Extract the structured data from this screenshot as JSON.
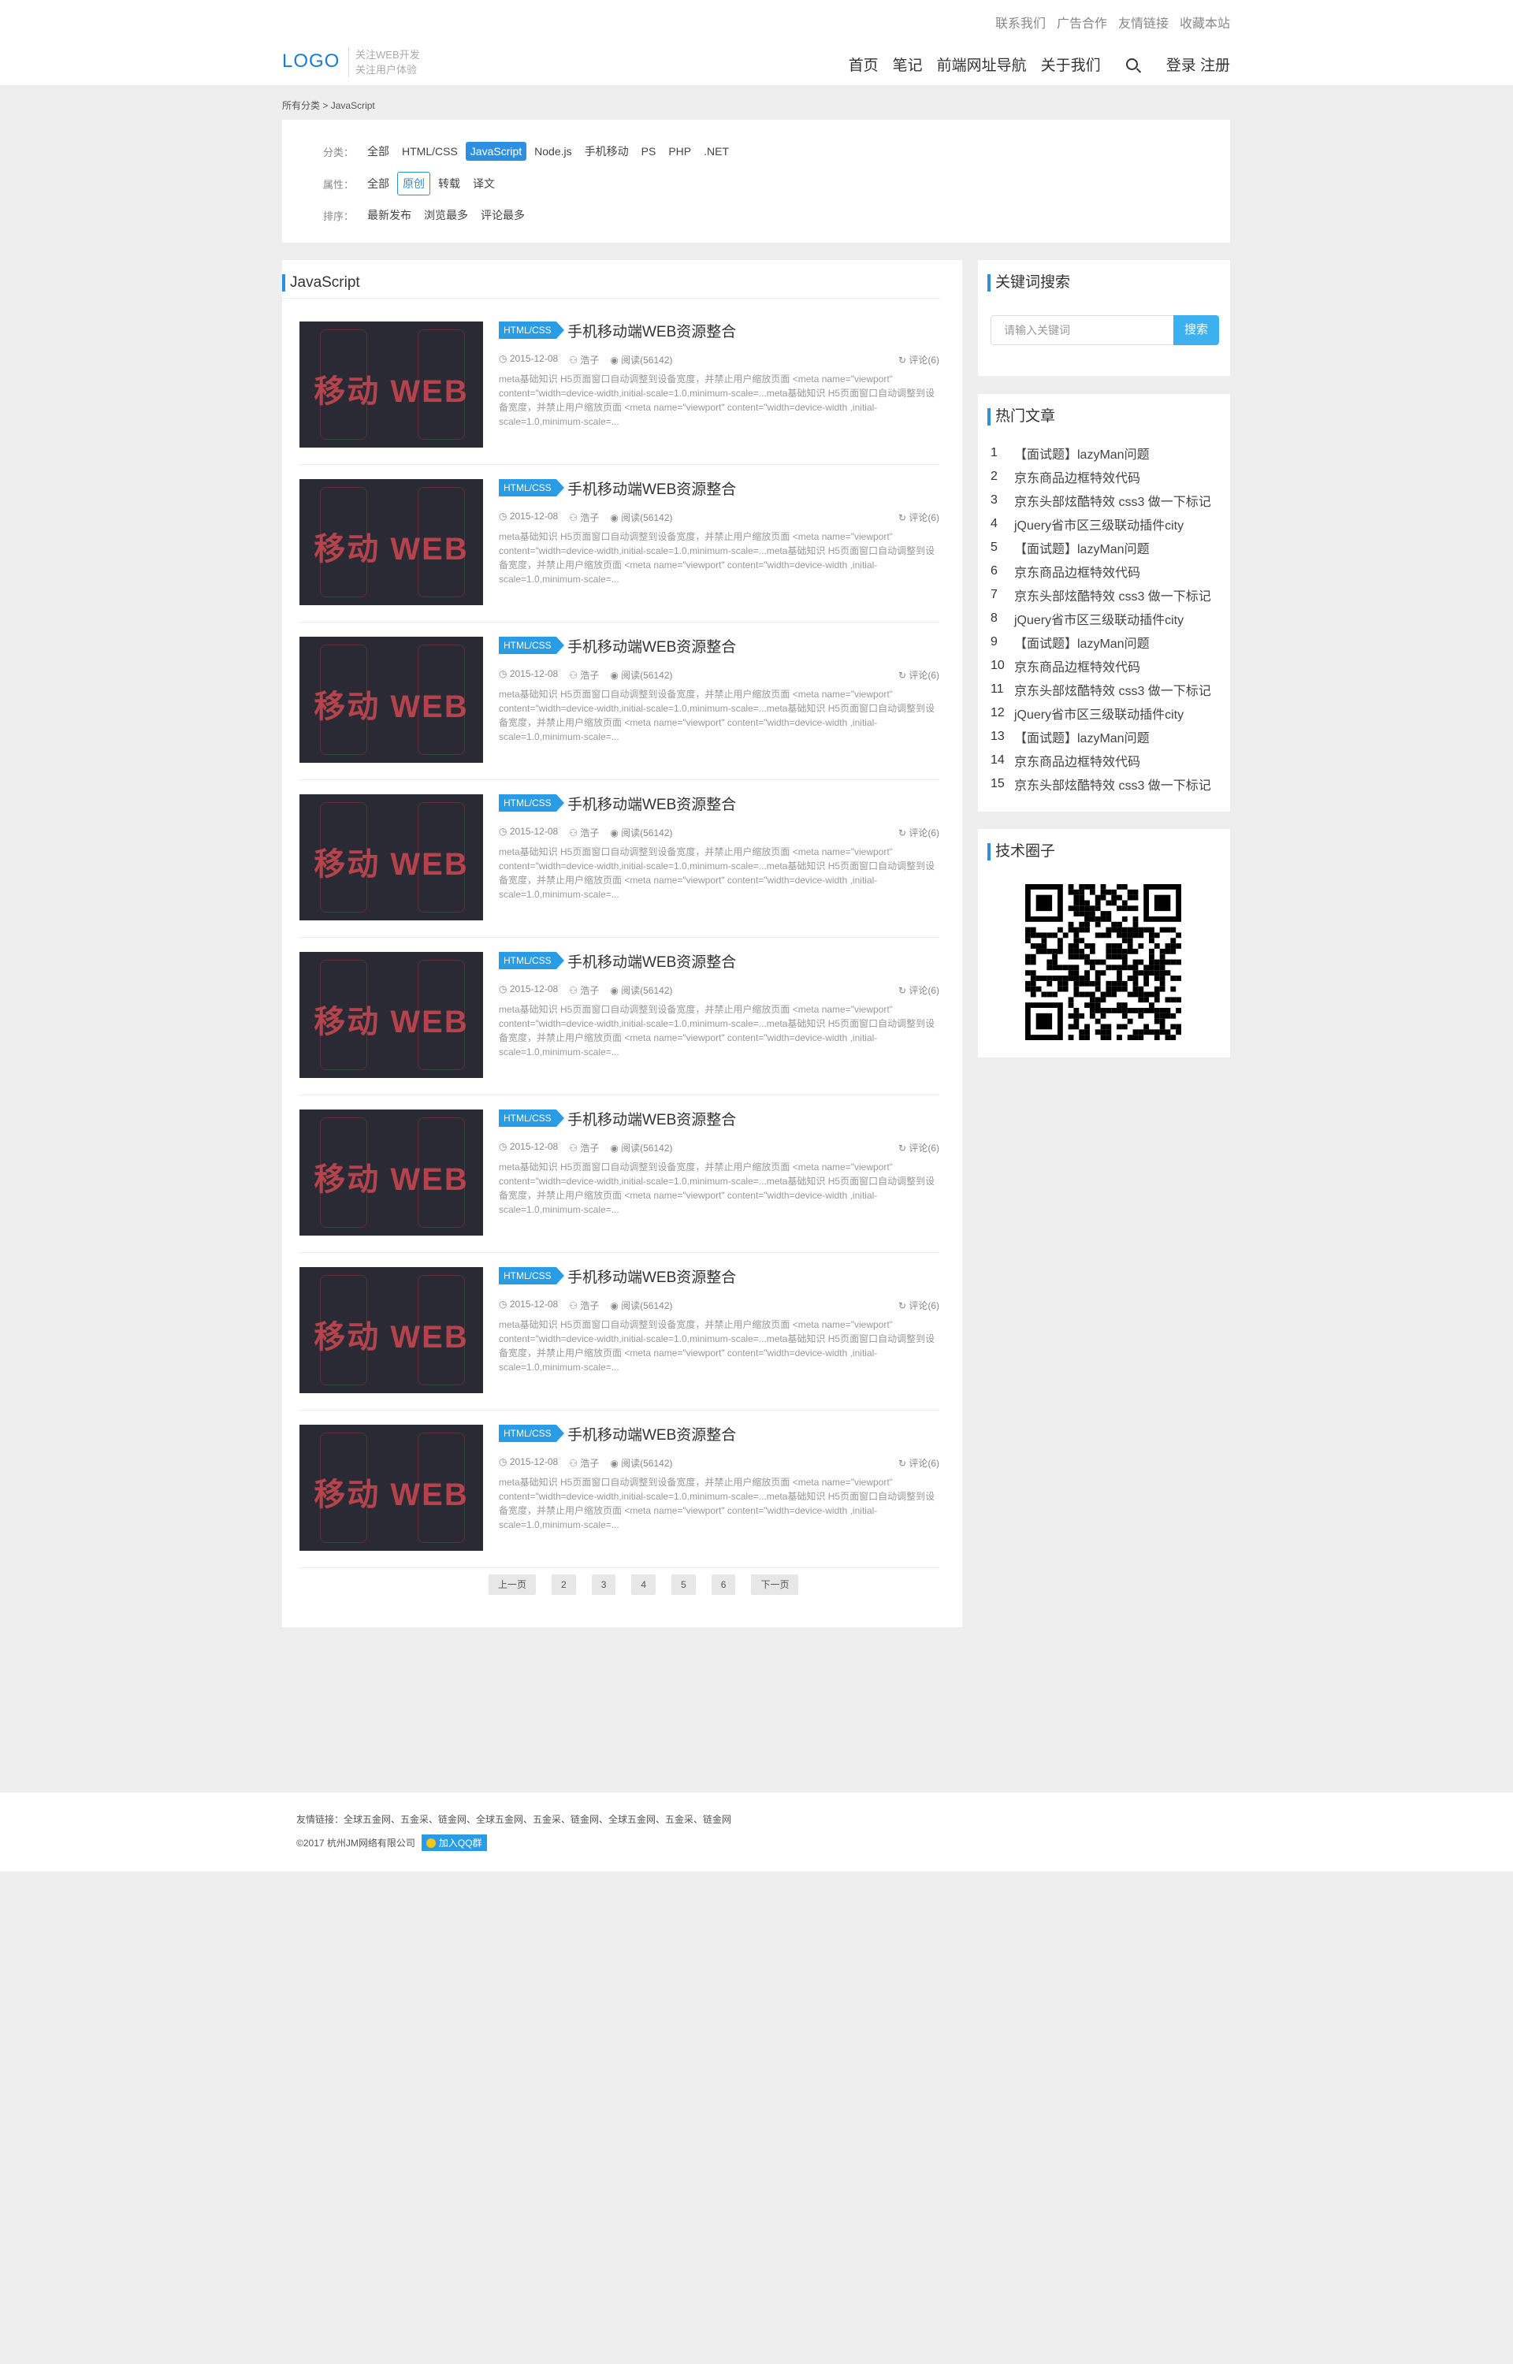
{
  "header": {
    "top_links": [
      "联系我们",
      "广告合作",
      "友情链接",
      "收藏本站"
    ],
    "logo": "LOGO",
    "slogan_line1": "关注WEB开发",
    "slogan_line2": "关注用户体验",
    "nav": [
      "首页",
      "笔记",
      "前端网址导航",
      "关于我们"
    ],
    "login": "登录",
    "register": "注册"
  },
  "breadcrumb": {
    "root": "所有分类",
    "separator": ">",
    "current": "JavaScript"
  },
  "filters": {
    "category_label": "分类：",
    "categories": [
      "全部",
      "HTML/CSS",
      "JavaScript",
      "Node.js",
      "手机移动",
      "PS",
      "PHP",
      ".NET"
    ],
    "attribute_label": "属性：",
    "attributes": [
      "全部",
      "原创",
      "转载",
      "译文"
    ],
    "sort_label": "排序：",
    "sorts": [
      "最新发布",
      "浏览最多",
      "评论最多"
    ]
  },
  "main": {
    "section_title": "JavaScript",
    "articles": [
      {
        "thumb_text": "移动 WEB",
        "tag": "HTML/CSS",
        "title": "手机移动端WEB资源整合",
        "date": "2015-12-08",
        "author": "浩子",
        "views": "阅读(56142)",
        "comments": "评论(6)",
        "excerpt": "meta基础知识 H5页面窗口自动调整到设备宽度，并禁止用户缩放页面 <meta name=\"viewport\" content=\"width=device-width,initial-scale=1.0,minimum-scale=...meta基础知识 H5页面窗口自动调整到设备宽度，并禁止用户缩放页面 <meta name=\"viewport\" content=\"width=device-width ,initial-scale=1.0,minimum-scale=..."
      },
      {
        "thumb_text": "移动 WEB",
        "tag": "HTML/CSS",
        "title": "手机移动端WEB资源整合",
        "date": "2015-12-08",
        "author": "浩子",
        "views": "阅读(56142)",
        "comments": "评论(6)",
        "excerpt": "meta基础知识 H5页面窗口自动调整到设备宽度，并禁止用户缩放页面 <meta name=\"viewport\" content=\"width=device-width,initial-scale=1.0,minimum-scale=...meta基础知识 H5页面窗口自动调整到设备宽度，并禁止用户缩放页面 <meta name=\"viewport\" content=\"width=device-width ,initial-scale=1.0,minimum-scale=..."
      },
      {
        "thumb_text": "移动 WEB",
        "tag": "HTML/CSS",
        "title": "手机移动端WEB资源整合",
        "date": "2015-12-08",
        "author": "浩子",
        "views": "阅读(56142)",
        "comments": "评论(6)",
        "excerpt": "meta基础知识 H5页面窗口自动调整到设备宽度，并禁止用户缩放页面 <meta name=\"viewport\" content=\"width=device-width,initial-scale=1.0,minimum-scale=...meta基础知识 H5页面窗口自动调整到设备宽度，并禁止用户缩放页面 <meta name=\"viewport\" content=\"width=device-width ,initial-scale=1.0,minimum-scale=..."
      },
      {
        "thumb_text": "移动 WEB",
        "tag": "HTML/CSS",
        "title": "手机移动端WEB资源整合",
        "date": "2015-12-08",
        "author": "浩子",
        "views": "阅读(56142)",
        "comments": "评论(6)",
        "excerpt": "meta基础知识 H5页面窗口自动调整到设备宽度，并禁止用户缩放页面 <meta name=\"viewport\" content=\"width=device-width,initial-scale=1.0,minimum-scale=...meta基础知识 H5页面窗口自动调整到设备宽度，并禁止用户缩放页面 <meta name=\"viewport\" content=\"width=device-width ,initial-scale=1.0,minimum-scale=..."
      },
      {
        "thumb_text": "移动 WEB",
        "tag": "HTML/CSS",
        "title": "手机移动端WEB资源整合",
        "date": "2015-12-08",
        "author": "浩子",
        "views": "阅读(56142)",
        "comments": "评论(6)",
        "excerpt": "meta基础知识 H5页面窗口自动调整到设备宽度，并禁止用户缩放页面 <meta name=\"viewport\" content=\"width=device-width,initial-scale=1.0,minimum-scale=...meta基础知识 H5页面窗口自动调整到设备宽度，并禁止用户缩放页面 <meta name=\"viewport\" content=\"width=device-width ,initial-scale=1.0,minimum-scale=..."
      },
      {
        "thumb_text": "移动 WEB",
        "tag": "HTML/CSS",
        "title": "手机移动端WEB资源整合",
        "date": "2015-12-08",
        "author": "浩子",
        "views": "阅读(56142)",
        "comments": "评论(6)",
        "excerpt": "meta基础知识 H5页面窗口自动调整到设备宽度，并禁止用户缩放页面 <meta name=\"viewport\" content=\"width=device-width,initial-scale=1.0,minimum-scale=...meta基础知识 H5页面窗口自动调整到设备宽度，并禁止用户缩放页面 <meta name=\"viewport\" content=\"width=device-width ,initial-scale=1.0,minimum-scale=..."
      },
      {
        "thumb_text": "移动 WEB",
        "tag": "HTML/CSS",
        "title": "手机移动端WEB资源整合",
        "date": "2015-12-08",
        "author": "浩子",
        "views": "阅读(56142)",
        "comments": "评论(6)",
        "excerpt": "meta基础知识 H5页面窗口自动调整到设备宽度，并禁止用户缩放页面 <meta name=\"viewport\" content=\"width=device-width,initial-scale=1.0,minimum-scale=...meta基础知识 H5页面窗口自动调整到设备宽度，并禁止用户缩放页面 <meta name=\"viewport\" content=\"width=device-width ,initial-scale=1.0,minimum-scale=..."
      },
      {
        "thumb_text": "移动 WEB",
        "tag": "HTML/CSS",
        "title": "手机移动端WEB资源整合",
        "date": "2015-12-08",
        "author": "浩子",
        "views": "阅读(56142)",
        "comments": "评论(6)",
        "excerpt": "meta基础知识 H5页面窗口自动调整到设备宽度，并禁止用户缩放页面 <meta name=\"viewport\" content=\"width=device-width,initial-scale=1.0,minimum-scale=...meta基础知识 H5页面窗口自动调整到设备宽度，并禁止用户缩放页面 <meta name=\"viewport\" content=\"width=device-width ,initial-scale=1.0,minimum-scale=..."
      }
    ],
    "pagination": [
      "上一页",
      "2",
      "3",
      "4",
      "5",
      "6",
      "下一页"
    ]
  },
  "sidebar": {
    "search_title": "关键词搜索",
    "search_placeholder": "请输入关键词",
    "search_button": "搜索",
    "hot_title": "热门文章",
    "hot_items": [
      {
        "num": "1",
        "title": "【面试题】lazyMan问题"
      },
      {
        "num": "2",
        "title": "京东商品边框特效代码"
      },
      {
        "num": "3",
        "title": "京东头部炫酷特效 css3 做一下标记"
      },
      {
        "num": "4",
        "title": "jQuery省市区三级联动插件city"
      },
      {
        "num": "5",
        "title": "【面试题】lazyMan问题"
      },
      {
        "num": "6",
        "title": "京东商品边框特效代码"
      },
      {
        "num": "7",
        "title": "京东头部炫酷特效 css3 做一下标记"
      },
      {
        "num": "8",
        "title": "jQuery省市区三级联动插件city"
      },
      {
        "num": "9",
        "title": "【面试题】lazyMan问题"
      },
      {
        "num": "10",
        "title": "京东商品边框特效代码"
      },
      {
        "num": "11",
        "title": "京东头部炫酷特效 css3 做一下标记"
      },
      {
        "num": "12",
        "title": "jQuery省市区三级联动插件city"
      },
      {
        "num": "13",
        "title": "【面试题】lazyMan问题"
      },
      {
        "num": "14",
        "title": "京东商品边框特效代码"
      },
      {
        "num": "15",
        "title": "京东头部炫酷特效 css3 做一下标记"
      }
    ],
    "circle_title": "技术圈子"
  },
  "footer": {
    "links_label": "友情链接：",
    "links": "全球五金网、五金采、链金网、全球五金网、五金采、链金网、全球五金网、五金采、链金网",
    "copyright": "©2017 杭州JM网络有限公司",
    "qq_button": "加入QQ群"
  },
  "colors": {
    "accent": "#2d8fe0",
    "tag": "#2a9be5",
    "search_button": "#3db1f0",
    "thumb_bg": "#2a2a35",
    "thumb_text": "#b5434b"
  }
}
